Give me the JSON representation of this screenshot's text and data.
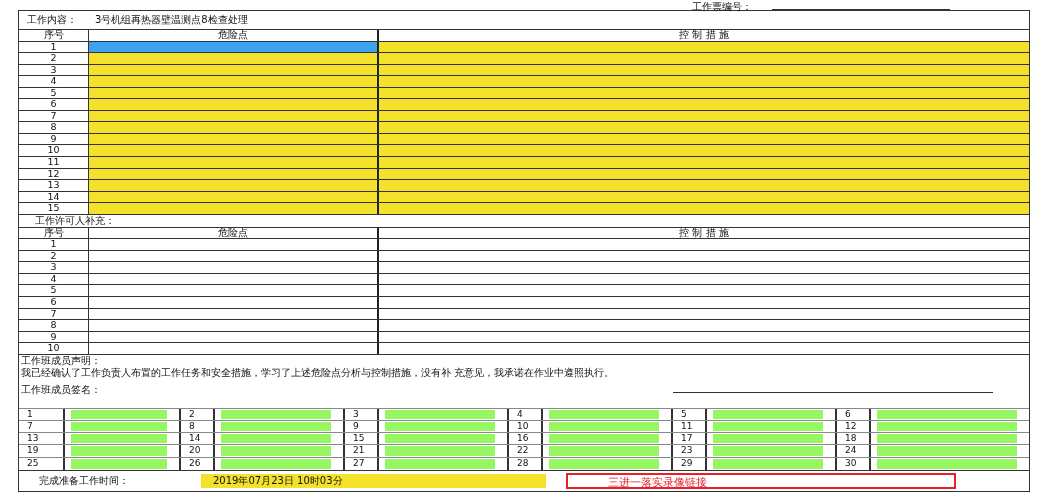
{
  "ticket_number": {
    "label": "工作票编号："
  },
  "work_content": {
    "label": "工作内容：",
    "value": "3号机组再热器壁温测点8检查处理"
  },
  "hazard_table": {
    "kind": "highlighted",
    "columns": [
      "序号",
      "危险点",
      "控 制 措 施"
    ],
    "rows": [
      {
        "no": "1",
        "selected": true
      },
      {
        "no": "2",
        "selected": false
      },
      {
        "no": "3",
        "selected": false
      },
      {
        "no": "4",
        "selected": false
      },
      {
        "no": "5",
        "selected": false
      },
      {
        "no": "6",
        "selected": false
      },
      {
        "no": "7",
        "selected": false
      },
      {
        "no": "8",
        "selected": false
      },
      {
        "no": "9",
        "selected": false
      },
      {
        "no": "10",
        "selected": false
      },
      {
        "no": "11",
        "selected": false
      },
      {
        "no": "12",
        "selected": false
      },
      {
        "no": "13",
        "selected": false
      },
      {
        "no": "14",
        "selected": false
      },
      {
        "no": "15",
        "selected": false
      }
    ]
  },
  "supplement": {
    "label": "工作许可人补充：",
    "table": {
      "columns": [
        "序号",
        "危险点",
        "控 制 措 施"
      ],
      "rows": [
        {
          "no": "1",
          "selected": false
        },
        {
          "no": "2",
          "selected": false
        },
        {
          "no": "3",
          "selected": false
        },
        {
          "no": "4",
          "selected": false
        },
        {
          "no": "5",
          "selected": false
        },
        {
          "no": "6",
          "selected": false
        },
        {
          "no": "7",
          "selected": false
        },
        {
          "no": "8",
          "selected": false
        },
        {
          "no": "9",
          "selected": false
        },
        {
          "no": "10",
          "selected": false
        }
      ]
    }
  },
  "declaration": {
    "title": "工作班成员声明：",
    "text": "我已经确认了工作负责人布置的工作任务和安全措施，学习了上述危险点分析与控制措施，没有补 充意见，我承诺在作业中遵照执行。"
  },
  "signatures": {
    "label": "工作班成员签名：",
    "slots": [
      "1",
      "2",
      "3",
      "4",
      "5",
      "6",
      "7",
      "8",
      "9",
      "10",
      "11",
      "12",
      "13",
      "14",
      "15",
      "16",
      "17",
      "18",
      "19",
      "20",
      "21",
      "22",
      "23",
      "24",
      "25",
      "26",
      "27",
      "28",
      "29",
      "30"
    ]
  },
  "completion": {
    "label": "完成准备工作时间：",
    "value": "2019年07月23日  10时03分",
    "link": "三进一落实录像链接"
  }
}
